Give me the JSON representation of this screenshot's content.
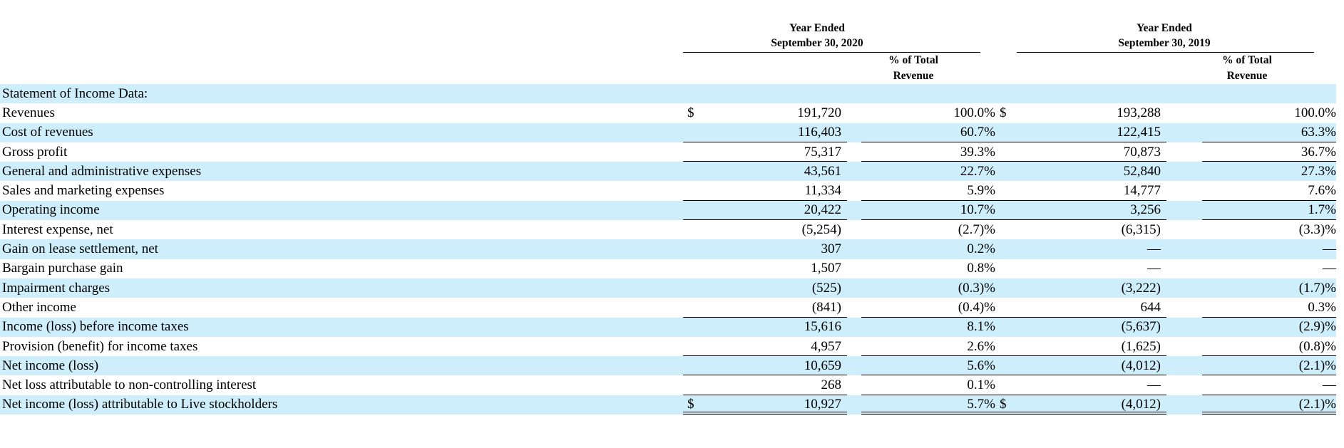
{
  "header": {
    "period_2020": {
      "line1": "Year Ended",
      "line2": "September 30, 2020",
      "pct_line1": "% of Total",
      "pct_line2": "Revenue"
    },
    "period_2019": {
      "line1": "Year Ended",
      "line2": "September 30, 2019",
      "pct_line1": "% of Total",
      "pct_line2": "Revenue"
    }
  },
  "rows": [
    {
      "label": "Statement of Income Data:",
      "d20": "",
      "v20": "",
      "p20": "",
      "d19": "",
      "v19": "",
      "p19": ""
    },
    {
      "label": "Revenues",
      "d20": "$",
      "v20": "191,720",
      "p20": "100.0%",
      "d19": "$",
      "v19": "193,288",
      "p19": "100.0%"
    },
    {
      "label": "Cost of revenues",
      "d20": "",
      "v20": "116,403",
      "p20": "60.7%",
      "d19": "",
      "v19": "122,415",
      "p19": "63.3%"
    },
    {
      "label": "Gross profit",
      "d20": "",
      "v20": "75,317",
      "p20": "39.3%",
      "d19": "",
      "v19": "70,873",
      "p19": "36.7%"
    },
    {
      "label": "General and administrative expenses",
      "d20": "",
      "v20": "43,561",
      "p20": "22.7%",
      "d19": "",
      "v19": "52,840",
      "p19": "27.3%"
    },
    {
      "label": "Sales and marketing expenses",
      "d20": "",
      "v20": "11,334",
      "p20": "5.9%",
      "d19": "",
      "v19": "14,777",
      "p19": "7.6%"
    },
    {
      "label": "Operating income",
      "d20": "",
      "v20": "20,422",
      "p20": "10.7%",
      "d19": "",
      "v19": "3,256",
      "p19": "1.7%"
    },
    {
      "label": "Interest expense, net",
      "d20": "",
      "v20": "(5,254)",
      "p20": "(2.7)%",
      "d19": "",
      "v19": "(6,315)",
      "p19": "(3.3)%"
    },
    {
      "label": "Gain on lease settlement, net",
      "d20": "",
      "v20": "307",
      "p20": "0.2%",
      "d19": "",
      "v19": "—",
      "p19": "—"
    },
    {
      "label": "Bargain purchase gain",
      "d20": "",
      "v20": "1,507",
      "p20": "0.8%",
      "d19": "",
      "v19": "—",
      "p19": "—"
    },
    {
      "label": "Impairment charges",
      "d20": "",
      "v20": "(525)",
      "p20": "(0.3)%",
      "d19": "",
      "v19": "(3,222)",
      "p19": "(1.7)%"
    },
    {
      "label": "Other income",
      "d20": "",
      "v20": "(841)",
      "p20": "(0.4)%",
      "d19": "",
      "v19": "644",
      "p19": "0.3%"
    },
    {
      "label": "Income (loss) before income taxes",
      "d20": "",
      "v20": "15,616",
      "p20": "8.1%",
      "d19": "",
      "v19": "(5,637)",
      "p19": "(2.9)%"
    },
    {
      "label": "Provision (benefit) for income taxes",
      "d20": "",
      "v20": "4,957",
      "p20": "2.6%",
      "d19": "",
      "v19": "(1,625)",
      "p19": "(0.8)%"
    },
    {
      "label": "Net income (loss)",
      "d20": "",
      "v20": "10,659",
      "p20": "5.6%",
      "d19": "",
      "v19": "(4,012)",
      "p19": "(2.1)%"
    },
    {
      "label": "Net loss attributable to non-controlling interest",
      "d20": "",
      "v20": "268",
      "p20": "0.1%",
      "d19": "",
      "v19": "—",
      "p19": "—"
    },
    {
      "label": "Net income (loss) attributable to Live stockholders",
      "d20": "$",
      "v20": "10,927",
      "p20": "5.7%",
      "d19": "$",
      "v19": "(4,012)",
      "p19": "(2.1)%"
    }
  ]
}
